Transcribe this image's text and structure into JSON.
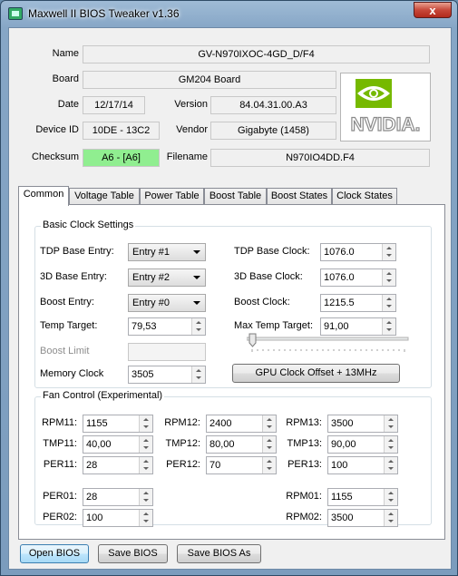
{
  "window": {
    "title": "Maxwell II BIOS Tweaker v1.36",
    "close_symbol": "x"
  },
  "info": {
    "name_label": "Name",
    "name": "GV-N970IXOC-4GD_D/F4",
    "board_label": "Board",
    "board": "GM204 Board",
    "date_label": "Date",
    "date": "12/17/14",
    "version_label": "Version",
    "version": "84.04.31.00.A3",
    "device_label": "Device ID",
    "device_id": "10DE - 13C2",
    "vendor_label": "Vendor",
    "vendor": "Gigabyte (1458)",
    "checksum_label": "Checksum",
    "checksum": "A6 - [A6]",
    "filename_label": "Filename",
    "filename": "N970IO4DD.F4",
    "logo_text": "NVIDIA."
  },
  "tabs": [
    "Common",
    "Voltage Table",
    "Power Table",
    "Boost Table",
    "Boost States",
    "Clock States"
  ],
  "active_tab": "Common",
  "basic": {
    "title": "Basic Clock Settings",
    "tdp_entry_label": "TDP Base Entry:",
    "tdp_entry": "Entry #1",
    "d3_entry_label": "3D Base Entry:",
    "d3_entry": "Entry #2",
    "boost_entry_label": "Boost Entry:",
    "boost_entry": "Entry #0",
    "temp_target_label": "Temp Target:",
    "temp_target": "79,53",
    "boost_limit_label": "Boost Limit",
    "boost_limit": "",
    "memory_clock_label": "Memory Clock",
    "memory_clock": "3505",
    "tdp_clock_label": "TDP Base Clock:",
    "tdp_clock": "1076.0",
    "d3_clock_label": "3D Base Clock:",
    "d3_clock": "1076.0",
    "boost_clock_label": "Boost Clock:",
    "boost_clock": "1215.5",
    "max_temp_label": "Max Temp Target:",
    "max_temp": "91,00",
    "offset_slider_level": 0,
    "offset_button": "GPU Clock Offset + 13MHz"
  },
  "fan": {
    "title": "Fan Control (Experimental)",
    "rpm11_label": "RPM11:",
    "rpm11": "1155",
    "tmp11_label": "TMP11:",
    "tmp11": "40,00",
    "per11_label": "PER11:",
    "per11": "28",
    "rpm12_label": "RPM12:",
    "rpm12": "2400",
    "tmp12_label": "TMP12:",
    "tmp12": "80,00",
    "per12_label": "PER12:",
    "per12": "70",
    "rpm13_label": "RPM13:",
    "rpm13": "3500",
    "tmp13_label": "TMP13:",
    "tmp13": "90,00",
    "per13_label": "PER13:",
    "per13": "100",
    "per01_label": "PER01:",
    "per01": "28",
    "per02_label": "PER02:",
    "per02": "100",
    "rpm01_label": "RPM01:",
    "rpm01": "1155",
    "rpm02_label": "RPM02:",
    "rpm02": "3500"
  },
  "buttons": {
    "open": "Open BIOS",
    "save": "Save BIOS",
    "save_as": "Save BIOS As"
  },
  "colors": {
    "checksum_ok": "#90ee90",
    "nvidia_green": "#76b900"
  }
}
